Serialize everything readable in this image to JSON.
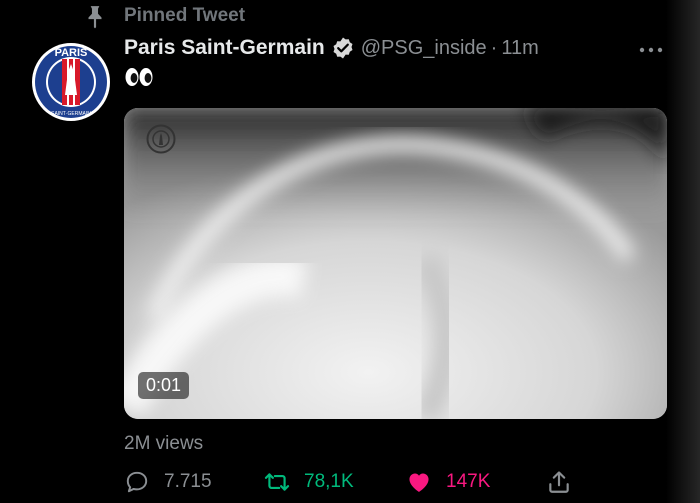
{
  "pinned": {
    "label": "Pinned Tweet",
    "icon": "pin-icon"
  },
  "author": {
    "name": "Paris Saint-Germain",
    "verified_icon": "verified-badge-icon",
    "handle": "@PSG_inside",
    "separator": "·",
    "time": "11m",
    "avatar_text_top": "PARIS",
    "avatar_text_bottom": "SAINT·GERMAIN"
  },
  "tweet": {
    "text_icon": "eyes-emoji-icon",
    "media": {
      "duration": "0:01",
      "logo": "psg-logo-icon"
    },
    "views": "2M views"
  },
  "actions": {
    "reply_count": "7.715",
    "retweet_count": "78,1K",
    "like_count": "147K",
    "share_icon": "share-icon"
  },
  "colors": {
    "background": "#000000",
    "muted_text": "#71767b",
    "retweet_green": "#00ba7c",
    "like_pink": "#f91880",
    "psg_navy": "#1d3f8f",
    "psg_red": "#d8192a"
  }
}
